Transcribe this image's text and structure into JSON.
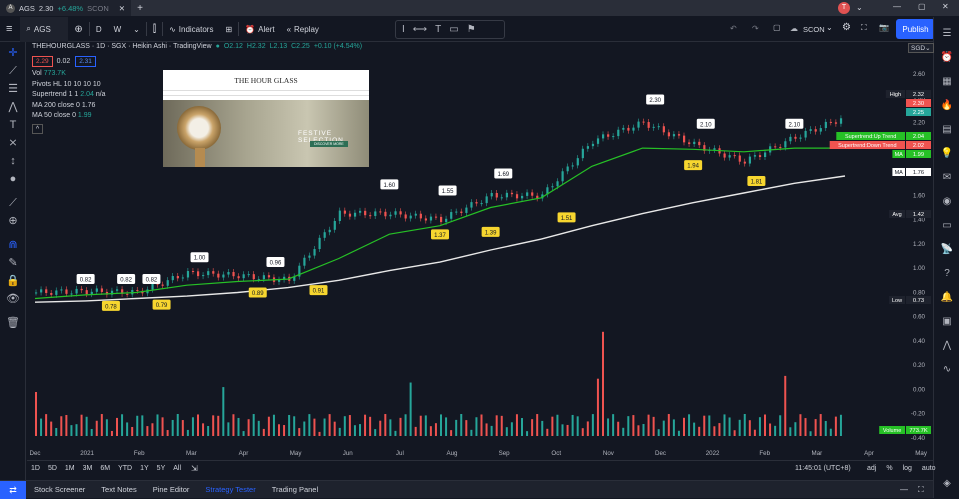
{
  "window": {
    "tab_symbol": "AGS",
    "tab_price": "2.30",
    "tab_change": "+6.48%",
    "tab_extra": "SCON",
    "avatar": "T"
  },
  "toolbar": {
    "symbol": "AGS",
    "interval": "D",
    "chart_type": "W",
    "indicators_label": "Indicators",
    "alert_label": "Alert",
    "replay_label": "Replay",
    "layout_name": "SCON",
    "publish_label": "Publish"
  },
  "legend": {
    "title": "THEHOURGLASS · 1D · SGX · Heikin Ashi · TradingView",
    "o": "O2.12",
    "h": "H2.32",
    "l": "L2.13",
    "c": "C2.25",
    "chg": "+0.10 (+4.54%)",
    "bid": "2.29",
    "spread": "0.02",
    "ask": "2.31",
    "vol_label": "Vol",
    "vol_value": "773.7K",
    "pivots": "Pivots HL 10 10 10 10",
    "supertrend_label": "Supertrend 1 1",
    "supertrend_value": "2.04",
    "supertrend_na": "n/a",
    "ma200_label": "MA 200 close 0",
    "ma200_value": "1.76",
    "ma50_label": "MA 50 close 0",
    "ma50_value": "1.99"
  },
  "ad_image": {
    "brand": "THE HOUR GLASS",
    "caption": "FESTIVE SELECTION",
    "button": "DISCOVER MORE"
  },
  "price_axis": {
    "currency_selector": "SGD",
    "ticks": [
      "2.60",
      "2.40",
      "2.20",
      "2.00",
      "1.80",
      "1.60",
      "1.40",
      "1.20",
      "1.00",
      "0.80",
      "0.60",
      "0.40",
      "0.20",
      "0.00",
      "-0.20",
      "-0.40"
    ],
    "badges": [
      {
        "label": "High",
        "value": "2.32"
      },
      {
        "label": "",
        "value": "2.30"
      },
      {
        "label": "",
        "value": "2.25"
      },
      {
        "label": "Supertrend:Up Trend",
        "value": "2.04"
      },
      {
        "label": "Supertrend:Down Trend",
        "value": "2.02"
      },
      {
        "label": "MA",
        "value": "1.99"
      },
      {
        "label": "MA",
        "value": "1.76"
      },
      {
        "label": "Avg",
        "value": "1.42"
      },
      {
        "label": "Low",
        "value": "0.73"
      },
      {
        "label": "Volume",
        "value": "773.7K"
      }
    ]
  },
  "time_axis": {
    "labels": [
      "Dec",
      "2021",
      "Feb",
      "Mar",
      "Apr",
      "May",
      "Jun",
      "Jul",
      "Aug",
      "Sep",
      "Oct",
      "Nov",
      "Dec",
      "2022",
      "Feb",
      "Mar",
      "Apr",
      "May"
    ]
  },
  "pivot_labels": {
    "highs": [
      "0.82",
      "0.82",
      "0.82",
      "1.00",
      "0.96",
      "1.60",
      "1.55",
      "1.69",
      "2.30",
      "2.10",
      "2.10"
    ],
    "lows": [
      "0.78",
      "0.79",
      "0.89",
      "0.91",
      "1.37",
      "1.39",
      "1.51",
      "1.94",
      "1.81"
    ]
  },
  "bottom_bar": {
    "timeframes": [
      "1D",
      "5D",
      "1M",
      "3M",
      "6M",
      "YTD",
      "1Y",
      "5Y",
      "All"
    ],
    "clock": "11:45:01 (UTC+8)",
    "options": [
      "adj",
      "%",
      "log",
      "auto"
    ]
  },
  "panel_tabs": [
    "Stock Screener",
    "Text Notes",
    "Pine Editor",
    "Strategy Tester",
    "Trading Panel"
  ],
  "active_panel_tab": "Strategy Tester",
  "chart_data": {
    "type": "line",
    "x": [
      "Dec",
      "2021",
      "Feb",
      "Mar",
      "Apr",
      "May",
      "Jun",
      "Jul",
      "Aug",
      "Sep",
      "Oct",
      "Nov",
      "Dec",
      "2022",
      "Feb",
      "Mar",
      "Apr"
    ],
    "series": [
      {
        "values": [
          0.8,
          0.81,
          0.8,
          0.96,
          0.94,
          0.9,
          1.45,
          1.45,
          1.4,
          1.6,
          1.6,
          2.05,
          2.2,
          2.02,
          1.88,
          2.08,
          2.25
        ]
      },
      {
        "values": [
          0.75,
          0.78,
          0.8,
          0.86,
          0.89,
          0.91,
          1.08,
          1.28,
          1.35,
          1.5,
          1.58,
          1.84,
          1.99,
          1.98,
          1.96,
          1.99,
          1.99
        ]
      },
      {
        "values": [
          0.72,
          0.73,
          0.75,
          0.77,
          0.8,
          0.84,
          0.9,
          0.98,
          1.05,
          1.15,
          1.24,
          1.35,
          1.45,
          1.54,
          1.62,
          1.7,
          1.76
        ]
      }
    ],
    "ylim": [
      -0.4,
      2.7
    ],
    "colors": {
      "ma50": "#26c026",
      "ma200": "#e8e8e8",
      "up": "#26a69a",
      "down": "#ef5350",
      "pivot": "#f7d62f"
    }
  }
}
